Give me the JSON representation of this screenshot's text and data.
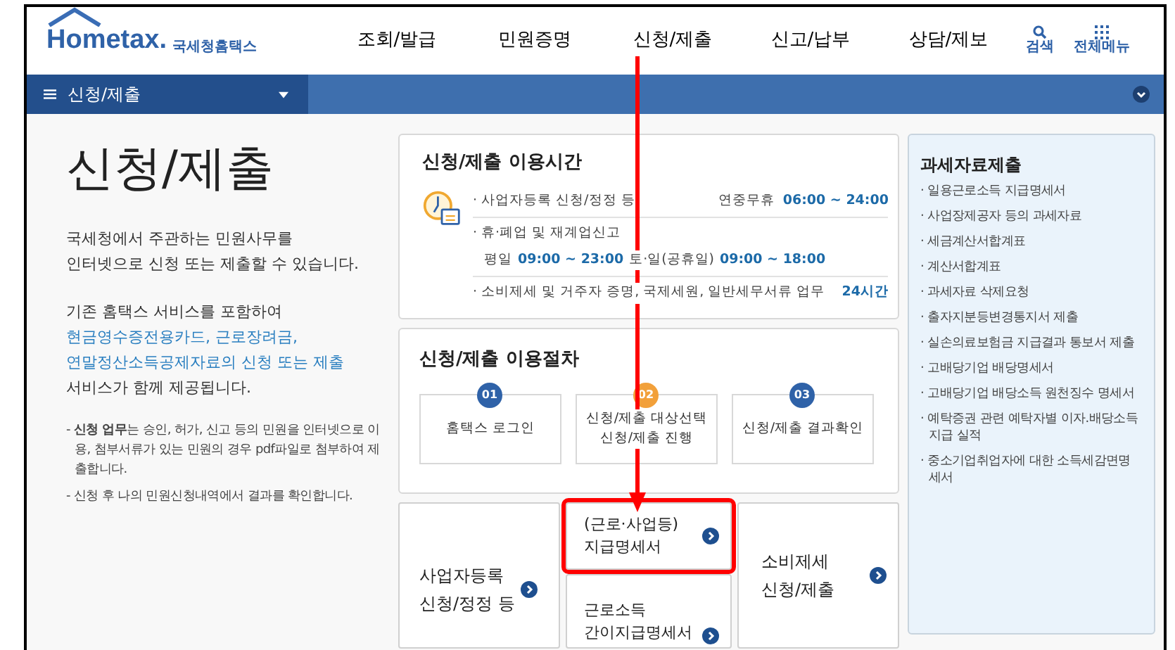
{
  "header": {
    "logo_text": "Hometax.",
    "logo_subtitle": "국세청홈택스",
    "nav": [
      "조회/발급",
      "민원증명",
      "신청/제출",
      "신고/납부",
      "상담/제보"
    ],
    "tools": [
      {
        "kind": "search",
        "label": "검색"
      },
      {
        "kind": "grid",
        "label": "전체메뉴"
      }
    ]
  },
  "breadcrumb": {
    "label": "신청/제출"
  },
  "intro": {
    "title": "신청/제출",
    "lines": [
      "국세청에서 주관하는 민원사무를",
      "인터넷으로 신청 또는 제출할 수 있습니다."
    ],
    "service_lead": "기존 홈택스 서비스를 포함하여",
    "service_links": [
      "현금영수증전용카드, 근로장려금,",
      "연말정산소득공제자료의 신청 또는 제출"
    ],
    "service_tail": "서비스가 함께 제공됩니다.",
    "notes": [
      "- **신청 업무**는 승인, 허가, 신고 등의 민원을 인터넷으로 이용, 첨부서류가 있는 민원의 경우 pdf파일로 첨부하여 제출합니다.",
      "- 신청 후 나의 민원신청내역에서 결과를 확인합니다."
    ]
  },
  "usage_hours": {
    "title": "신청/제출 이용시간",
    "rows": [
      {
        "label": "· 사업자등록 신청/정정 등",
        "detail": "연중무휴",
        "hours": "06:00 ~ 24:00"
      },
      {
        "label": "· 휴·폐업 및 재계업신고",
        "line2": [
          {
            "text": "평일",
            "time": "09:00 ~ 23:00"
          },
          {
            "text": "토·일(공휴일)",
            "time": "09:00 ~ 18:00"
          }
        ]
      },
      {
        "label": "· 소비제세 및 거주자 증명, 국제세원, 일반세무서류 업무",
        "hours": "24시간"
      }
    ]
  },
  "procedure": {
    "title": "신청/제출 이용절차",
    "steps": [
      {
        "number": "01",
        "color": "#2f62a8",
        "lines": [
          "홈택스 로그인"
        ]
      },
      {
        "number": "02",
        "color": "#f2a03a",
        "lines": [
          "신청/제출 대상선택",
          "신청/제출 진행"
        ]
      },
      {
        "number": "03",
        "color": "#2f62a8",
        "lines": [
          "신청/제출 결과확인"
        ]
      }
    ]
  },
  "shortcuts": [
    {
      "lines": [
        "사업자등록",
        "신청/정정 등"
      ],
      "highlighted": false
    },
    {
      "lines": [
        "(근로·사업등)",
        "지급명세서"
      ],
      "highlighted": true
    },
    {
      "lines": [
        "근로소득",
        "간이지급명세서"
      ],
      "highlighted": false
    },
    {
      "lines": [
        "소비제세",
        "신청/제출"
      ],
      "highlighted": false
    }
  ],
  "side_panel": {
    "title": "과세자료제출",
    "items": [
      "· 일용근로소득 지급명세서",
      "· 사업장제공자 등의 과세자료",
      "· 세금계산서합계표",
      "· 계산서합계표",
      "· 과세자료 삭제요청",
      "· 출자지분등변경통지서 제출",
      "· 실손의료보험금 지급결과 통보서 제출",
      "· 고배당기업 배당명세서",
      "· 고배당기업 배당소득 원천징수 명세서",
      "· 예탁증권 관련 예탁자별 이자.배당소득 지급 실적",
      "· 중소기업취업자에 대한 소득세감면명세서"
    ]
  }
}
